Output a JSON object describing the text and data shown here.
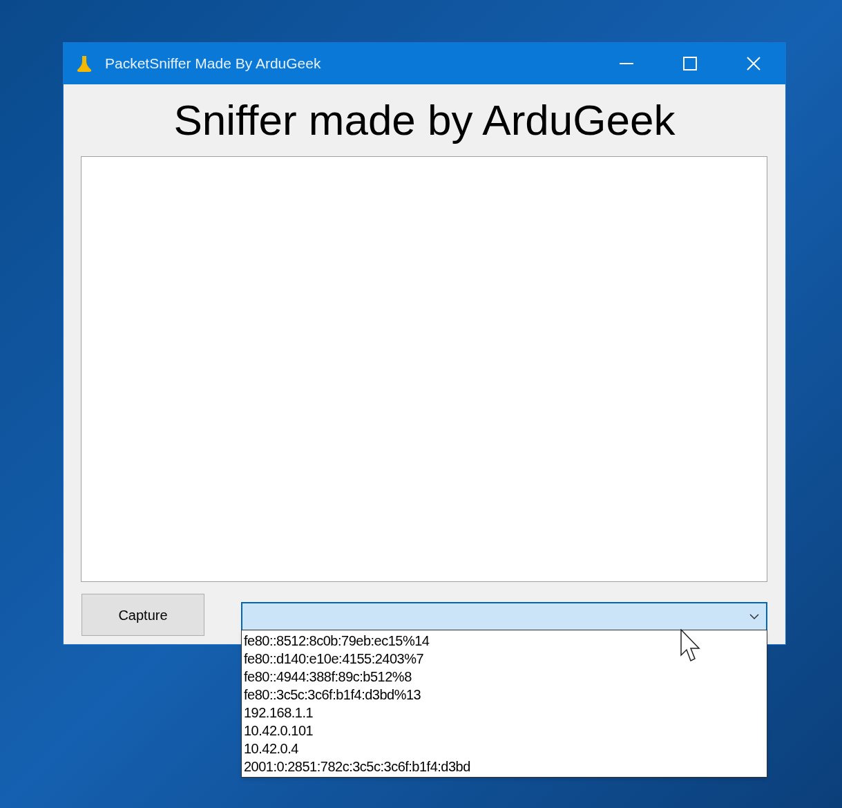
{
  "window": {
    "title": "PacketSniffer Made By ArduGeek"
  },
  "heading": "Sniffer made by ArduGeek",
  "capture_button": "Capture",
  "interface_dropdown": {
    "expanded": true,
    "options": [
      "fe80::8512:8c0b:79eb:ec15%14",
      "fe80::d140:e10e:4155:2403%7",
      "fe80::4944:388f:89c:b512%8",
      "fe80::3c5c:3c6f:b1f4:d3bd%13",
      "192.168.1.1",
      "10.42.0.101",
      "10.42.0.4",
      "2001:0:2851:782c:3c5c:3c6f:b1f4:d3bd"
    ]
  }
}
